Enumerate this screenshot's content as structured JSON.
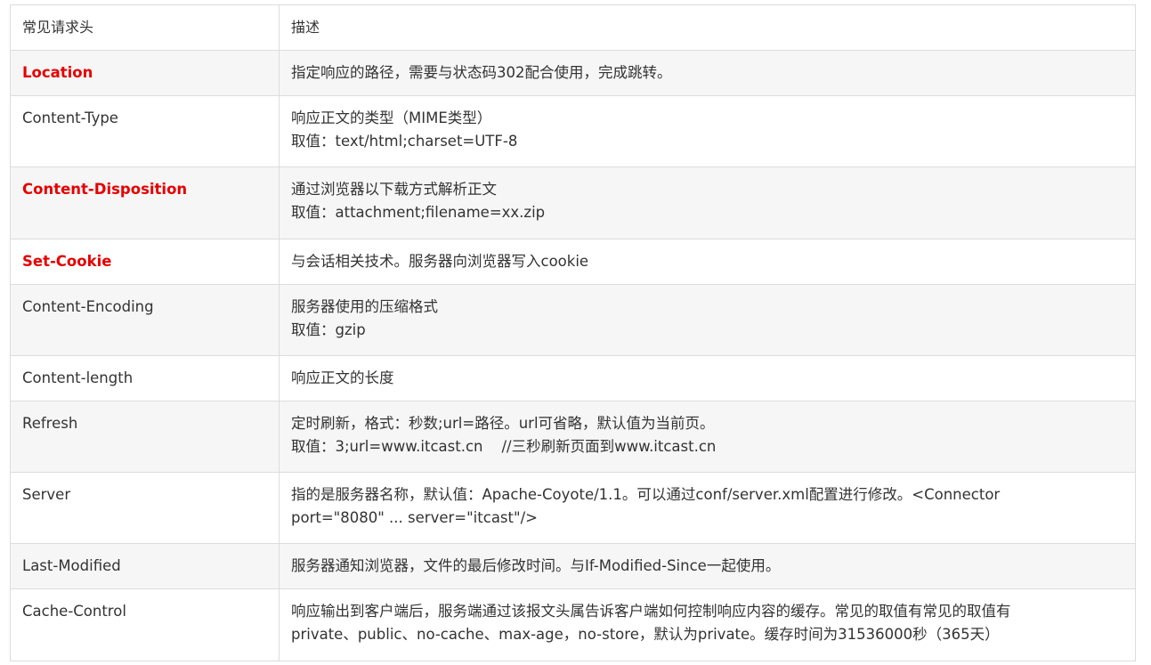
{
  "table": {
    "headers": [
      "常见请求头",
      "描述"
    ],
    "rows": [
      {
        "name": "Location",
        "highlight": true,
        "desc": [
          "指定响应的路径，需要与状态码302配合使用，完成跳转。"
        ]
      },
      {
        "name": "Content-Type",
        "highlight": false,
        "desc": [
          "响应正文的类型（MIME类型）",
          "取值：text/html;charset=UTF-8"
        ]
      },
      {
        "name": "Content-Disposition",
        "highlight": true,
        "desc": [
          "通过浏览器以下载方式解析正文",
          "取值：attachment;filename=xx.zip"
        ]
      },
      {
        "name": "Set-Cookie",
        "highlight": true,
        "desc": [
          "与会话相关技术。服务器向浏览器写入cookie"
        ]
      },
      {
        "name": "Content-Encoding",
        "highlight": false,
        "desc": [
          "服务器使用的压缩格式",
          "取值：gzip"
        ]
      },
      {
        "name": "Content-length",
        "highlight": false,
        "desc": [
          "响应正文的长度"
        ]
      },
      {
        "name": "Refresh",
        "highlight": false,
        "desc": [
          "定时刷新，格式：秒数;url=路径。url可省略，默认值为当前页。",
          "取值：3;url=www.itcast.cn    //三秒刷新页面到www.itcast.cn"
        ]
      },
      {
        "name": "Server",
        "highlight": false,
        "desc": [
          "指的是服务器名称，默认值：Apache-Coyote/1.1。可以通过conf/server.xml配置进行修改。<Connector port=\"8080\" ... server=\"itcast\"/>"
        ]
      },
      {
        "name": "Last-Modified",
        "highlight": false,
        "desc": [
          "服务器通知浏览器，文件的最后修改时间。与If-Modified-Since一起使用。"
        ]
      },
      {
        "name": "Cache-Control",
        "highlight": false,
        "desc": [
          "响应输出到客户端后，服务端通过该报文头属告诉客户端如何控制响应内容的缓存。常见的取值有常见的取值有",
          "private、public、no-cache、max-age，no-store，默认为private。缓存时间为31536000秒（365天）"
        ]
      }
    ]
  },
  "colors": {
    "highlight_text": "#e60000",
    "border": "#dcdcdc",
    "row_alt_bg": "#f6f6f6",
    "text": "#333333"
  }
}
